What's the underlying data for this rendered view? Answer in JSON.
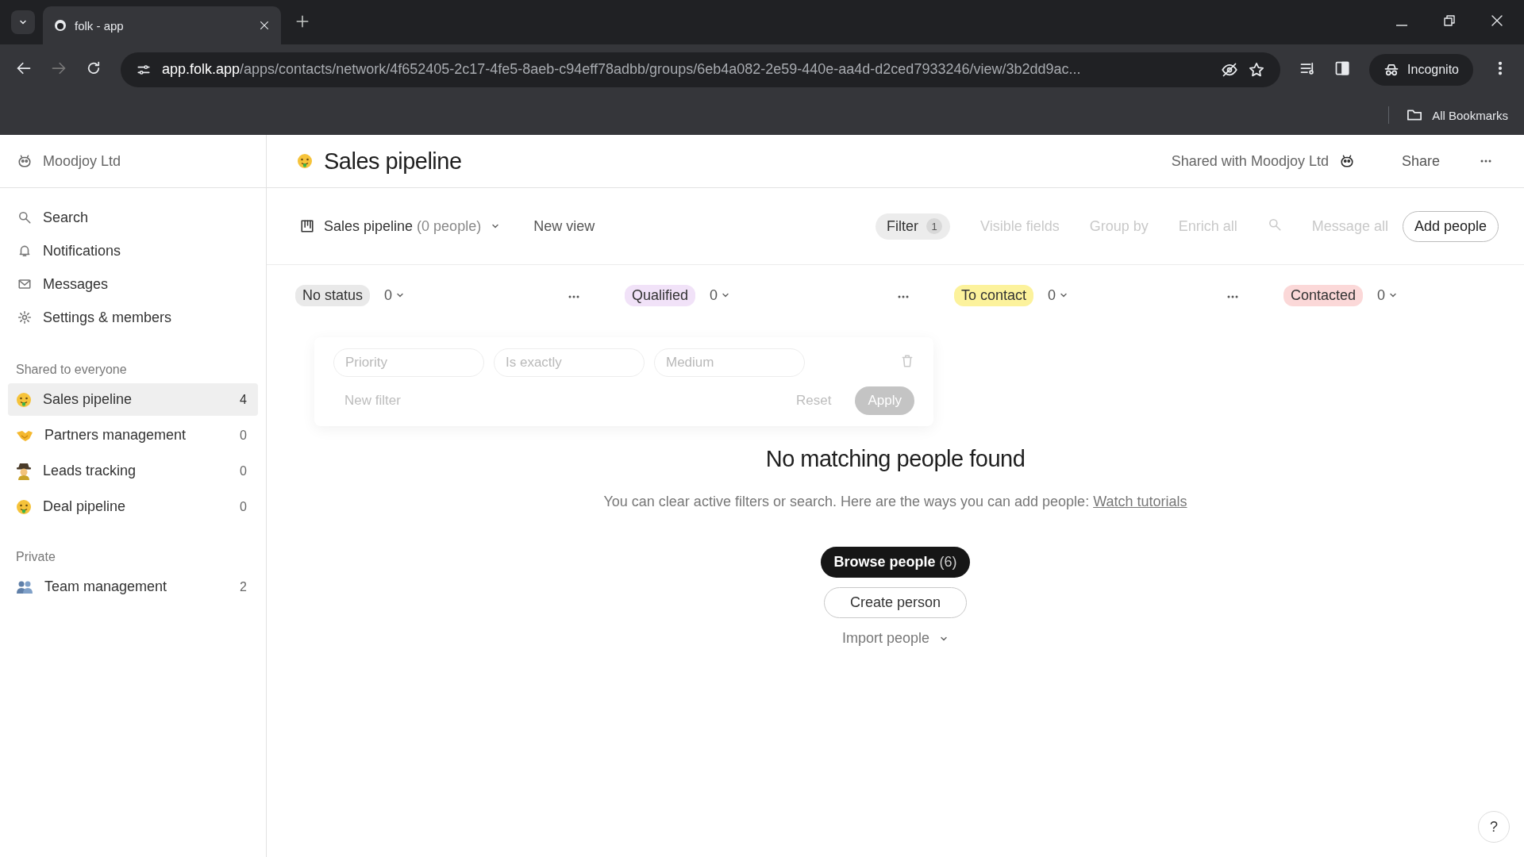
{
  "browser": {
    "tab_title": "folk - app",
    "url_host": "app.folk.app",
    "url_path": "/apps/contacts/network/4f652405-2c17-4fe5-8aeb-c94eff78adbb/groups/6eb4a082-2e59-440e-aa4d-d2ced7933246/view/3b2dd9ac...",
    "profile": "Incognito",
    "bookmarks": "All Bookmarks"
  },
  "sidebar": {
    "workspace": "Moodjoy Ltd",
    "nav": [
      {
        "label": "Search"
      },
      {
        "label": "Notifications"
      },
      {
        "label": "Messages"
      },
      {
        "label": "Settings & members"
      }
    ],
    "sections": [
      {
        "title": "Shared to everyone",
        "groups": [
          {
            "label": "Sales pipeline",
            "count": "4",
            "selected": true
          },
          {
            "label": "Partners management",
            "count": "0",
            "selected": false
          },
          {
            "label": "Leads tracking",
            "count": "0",
            "selected": false
          },
          {
            "label": "Deal pipeline",
            "count": "0",
            "selected": false
          }
        ]
      },
      {
        "title": "Private",
        "groups": [
          {
            "label": "Team management",
            "count": "2",
            "selected": false
          }
        ]
      }
    ]
  },
  "header": {
    "title": "Sales pipeline",
    "shared": "Shared with Moodjoy Ltd",
    "share": "Share"
  },
  "toolbar": {
    "view": "Sales pipeline",
    "view_count": "(0 people)",
    "new_view": "New view",
    "filter": {
      "label": "Filter",
      "count": "1"
    },
    "actions": [
      {
        "label": "Visible fields",
        "disabled": true
      },
      {
        "label": "Group by",
        "disabled": true
      },
      {
        "label": "Enrich all",
        "disabled": true
      }
    ],
    "message_all": {
      "label": "Message all",
      "disabled": true
    },
    "add_people": "Add people"
  },
  "columns": [
    {
      "label": "No status",
      "count": "0",
      "color": "#e9e9e9",
      "has_menu": true
    },
    {
      "label": "Qualified",
      "count": "0",
      "color": "#f1e2f8",
      "has_menu": true
    },
    {
      "label": "To contact",
      "count": "0",
      "color": "#fcf29c",
      "has_menu": true
    },
    {
      "label": "Contacted",
      "count": "0",
      "color": "#fbd8d8",
      "has_menu": false
    }
  ],
  "filter_popover": {
    "fields": [
      {
        "value": "Priority"
      },
      {
        "value": "Is exactly"
      },
      {
        "value": "Medium"
      }
    ],
    "new_filter": "New filter",
    "reset": "Reset",
    "apply": "Apply"
  },
  "empty_state": {
    "title": "No matching people found",
    "text": "You can clear active filters or search. Here are the ways you can add people:",
    "link": "Watch tutorials",
    "browse": {
      "label": "Browse people",
      "count": "(6)"
    },
    "create": "Create person",
    "import": "Import people"
  },
  "help": "?"
}
